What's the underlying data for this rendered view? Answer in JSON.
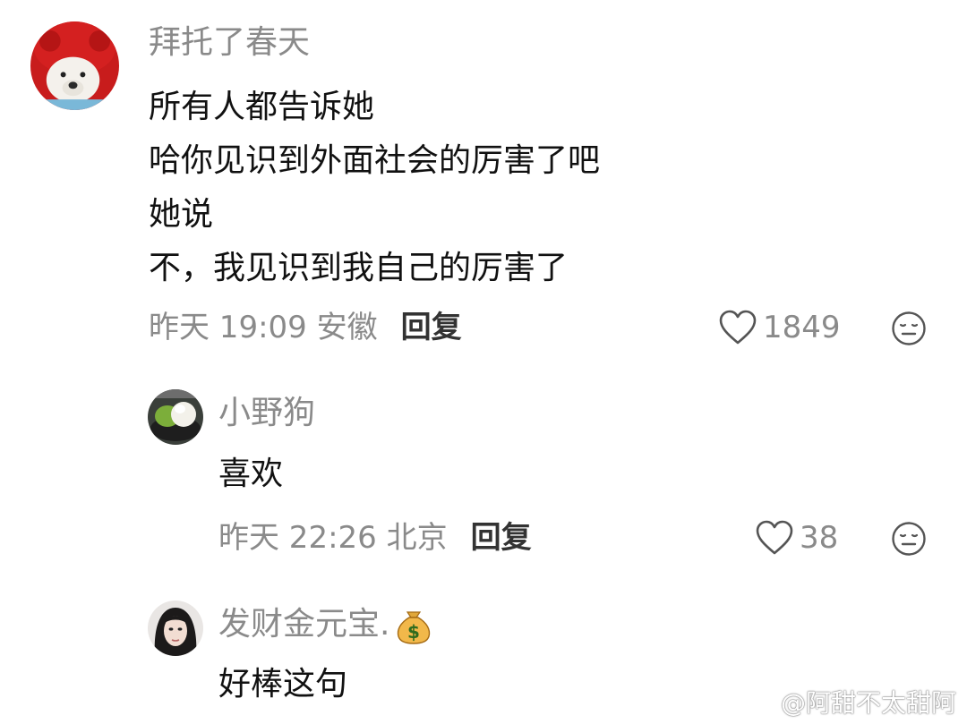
{
  "comment": {
    "username": "拜托了春天",
    "avatar_icon": "polar-bear-red-hat-avatar",
    "lines": [
      "所有人都告诉她",
      "哈你见识到外面社会的厉害了吧",
      "她说",
      "不，我见识到我自己的厉害了"
    ],
    "meta": "昨天 19:09 安徽",
    "reply_label": "回复",
    "likes": "1849"
  },
  "replies": [
    {
      "username": "小野狗",
      "avatar_icon": "green-tea-dessert-avatar",
      "text": "喜欢",
      "meta": "昨天 22:26 北京",
      "reply_label": "回复",
      "likes": "38"
    },
    {
      "username": "发财金元宝.",
      "username_icon": "money-bag-icon",
      "avatar_icon": "woman-portrait-avatar",
      "text": "好棒这句"
    }
  ],
  "watermark": {
    "icon": "weibo-icon",
    "text": "@阿甜不太甜阿"
  },
  "colors": {
    "secondary_text": "#8a8a8a",
    "primary_text": "#111111",
    "reply_text": "#333333"
  }
}
